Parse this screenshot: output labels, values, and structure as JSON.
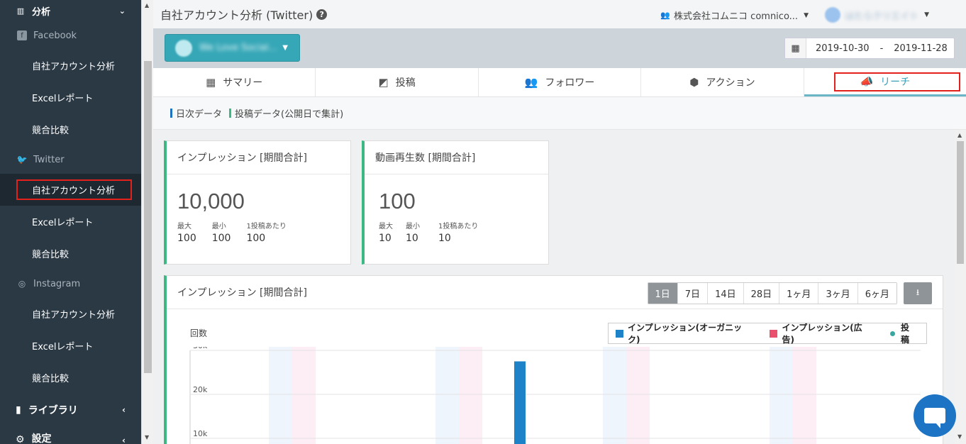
{
  "sidebar": {
    "top_section": "分析",
    "groups": [
      {
        "name": "Facebook",
        "icon": "facebook-icon",
        "items": [
          "自社アカウント分析",
          "Excelレポート",
          "競合比較"
        ]
      },
      {
        "name": "Twitter",
        "icon": "twitter-icon",
        "items": [
          "自社アカウント分析",
          "Excelレポート",
          "競合比較"
        ]
      },
      {
        "name": "Instagram",
        "icon": "instagram-icon",
        "items": [
          "自社アカウント分析",
          "Excelレポート",
          "競合比較"
        ]
      }
    ],
    "library": "ライブラリ",
    "settings": "設定"
  },
  "header": {
    "title": "自社アカウント分析 (Twitter)",
    "company": "株式会社コムニコ comnico...",
    "user": "はたらクリエイト"
  },
  "account": {
    "name": "We Love Social..."
  },
  "date_range": {
    "start": "2019-10-30",
    "separator": "-",
    "end": "2019-11-28"
  },
  "tabs": [
    {
      "label": "サマリー",
      "icon": "dashboard-icon"
    },
    {
      "label": "投稿",
      "icon": "post-icon"
    },
    {
      "label": "フォロワー",
      "icon": "users-icon"
    },
    {
      "label": "アクション",
      "icon": "action-icon"
    },
    {
      "label": "リーチ",
      "icon": "megaphone-icon",
      "active": true
    }
  ],
  "subnav": [
    {
      "label": "日次データ",
      "color": "#1e73be"
    },
    {
      "label": "投稿データ(公開日で集計)",
      "color": "#3db883"
    }
  ],
  "cards": [
    {
      "title": "インプレッション [期間合計]",
      "value": "10,000",
      "stats": [
        {
          "k": "最大",
          "v": "100"
        },
        {
          "k": "最小",
          "v": "100"
        },
        {
          "k": "1投稿あたり",
          "v": "100"
        }
      ]
    },
    {
      "title": "動画再生数 [期間合計]",
      "value": "100",
      "stats": [
        {
          "k": "最大",
          "v": "10"
        },
        {
          "k": "最小",
          "v": "10"
        },
        {
          "k": "1投稿あたり",
          "v": "10"
        }
      ]
    }
  ],
  "chart_card": {
    "title": "インプレッション [期間合計]",
    "periods": [
      "1日",
      "7日",
      "14日",
      "28日",
      "1ヶ月",
      "3ヶ月",
      "6ヶ月"
    ],
    "selected_period": "1日"
  },
  "chart_data": {
    "type": "bar",
    "ylabel": "回数",
    "y_ticks": [
      "30k",
      "20k",
      "10k"
    ],
    "ylim": [
      0,
      30000
    ],
    "legend": [
      {
        "name": "インプレッション(オーガニック)",
        "color": "#1e82c8"
      },
      {
        "name": "インプレッション(広告)",
        "color": "#e8506e"
      },
      {
        "name": "投稿",
        "color": "#3aa6a0"
      }
    ],
    "series": [
      {
        "name": "インプレッション(オーガニック)",
        "values": [
          27500
        ]
      }
    ]
  }
}
